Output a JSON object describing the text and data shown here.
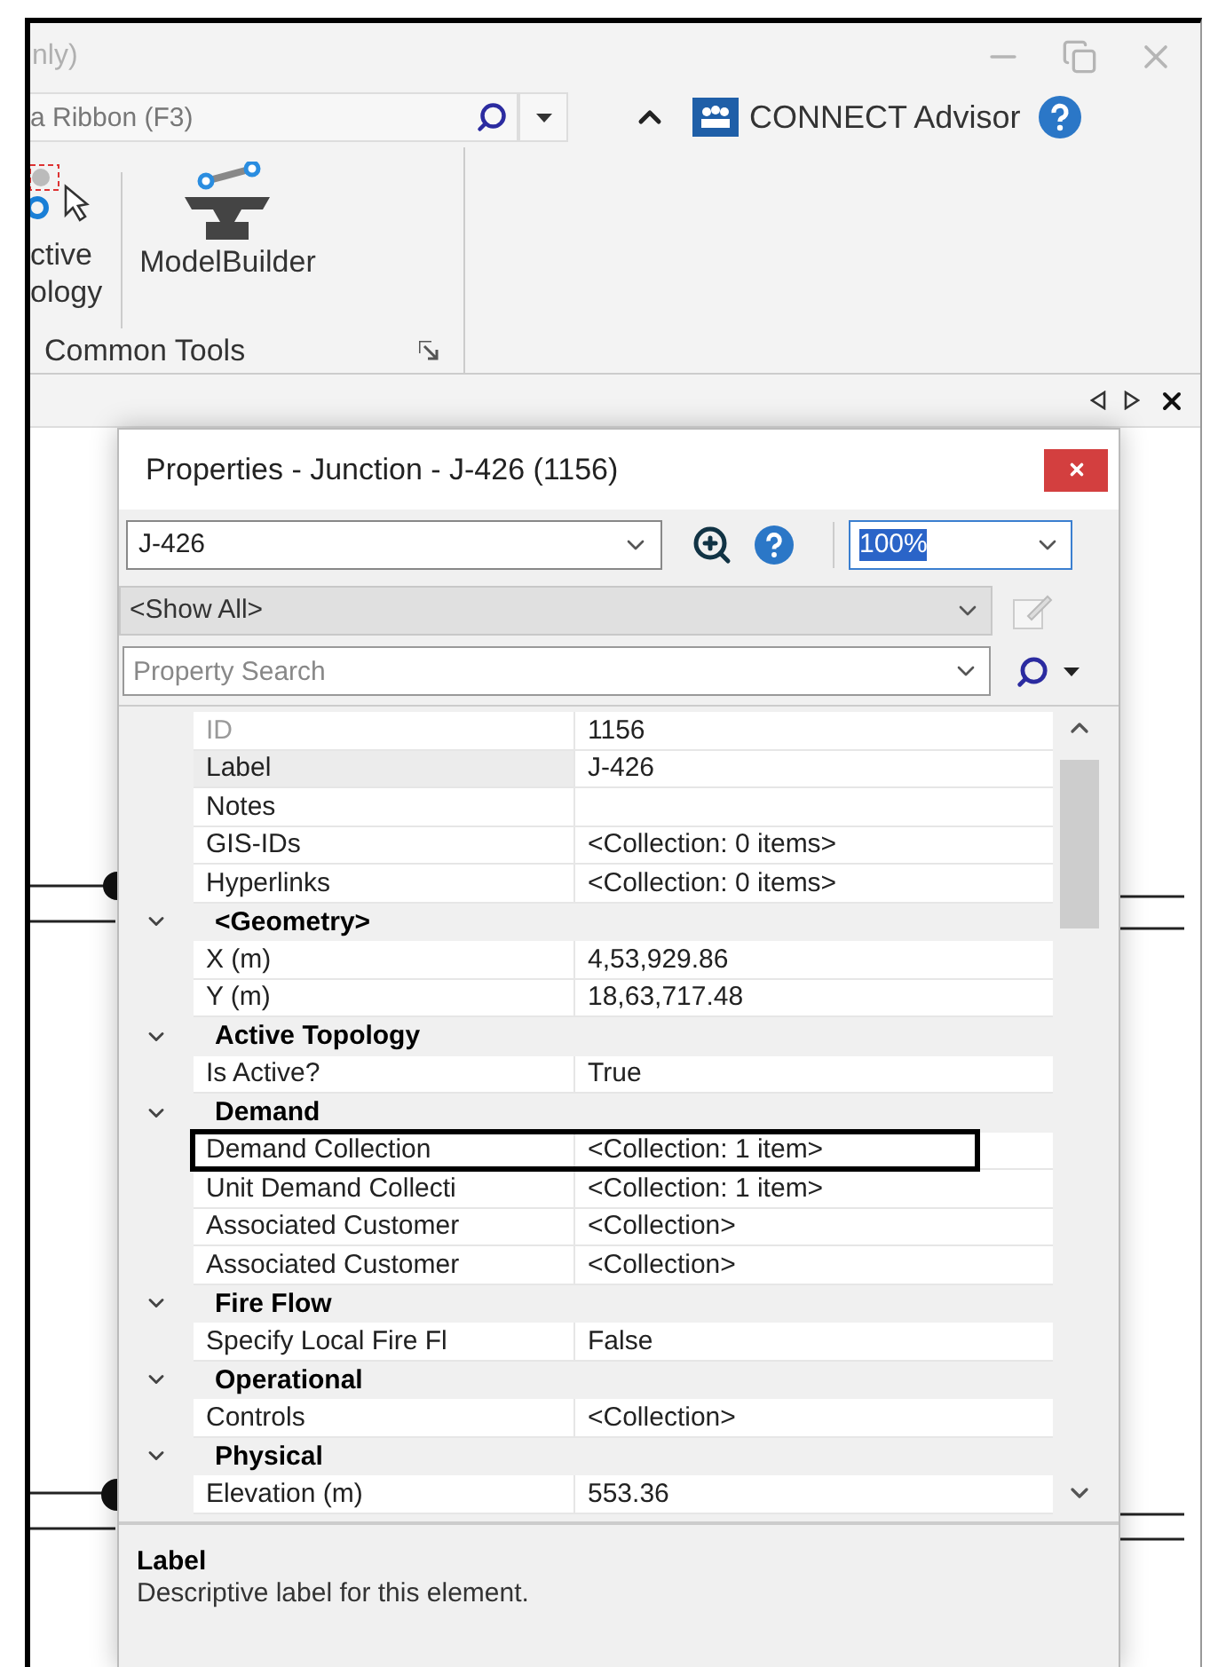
{
  "window": {
    "title": "nly)"
  },
  "ribbon_search": {
    "placeholder": "a Ribbon (F3)"
  },
  "connect_advisor": {
    "label": "CONNECT Advisor"
  },
  "ribbon": {
    "groups": [
      {
        "label": "Common Tools",
        "buttons": [
          {
            "kind": "topology",
            "lines": [
              "ctive",
              "ology"
            ]
          },
          {
            "kind": "modelbuilder",
            "lines": [
              "ModelBuilder"
            ]
          }
        ]
      }
    ]
  },
  "properties_dialog": {
    "title": "Properties - Junction - J-426 (1156)",
    "element": {
      "value": "J-426"
    },
    "zoom": {
      "value": "100%"
    },
    "filter": {
      "value": "<Show All>"
    },
    "search": {
      "placeholder": "Property Search"
    },
    "grid": [
      {
        "kind": "property",
        "name": "ID",
        "value": "1156",
        "disabled": true,
        "selected": false,
        "highlighted": false
      },
      {
        "kind": "property",
        "name": "Label",
        "value": "J-426",
        "disabled": false,
        "selected": true,
        "highlighted": false
      },
      {
        "kind": "property",
        "name": "Notes",
        "disabled": false,
        "selected": false,
        "highlighted": false
      },
      {
        "kind": "property",
        "name": "GIS-IDs",
        "value": "<Collection: 0 items>",
        "disabled": false,
        "selected": false,
        "highlighted": false
      },
      {
        "kind": "property",
        "name": "Hyperlinks",
        "value": "<Collection: 0 items>",
        "disabled": false,
        "selected": false,
        "highlighted": false
      },
      {
        "kind": "category",
        "name": "<Geometry>",
        "expanded": true,
        "children": [
          {
            "kind": "property",
            "name": "X (m)",
            "value": "4,53,929.86",
            "disabled": false,
            "selected": false,
            "highlighted": false
          },
          {
            "kind": "property",
            "name": "Y (m)",
            "value": "18,63,717.48",
            "disabled": false,
            "selected": false,
            "highlighted": false
          }
        ]
      },
      {
        "kind": "category",
        "name": "Active Topology",
        "expanded": true,
        "children": [
          {
            "kind": "property",
            "name": "Is Active?",
            "value": "True",
            "disabled": false,
            "selected": false,
            "highlighted": false
          }
        ]
      },
      {
        "kind": "category",
        "name": "Demand",
        "expanded": true,
        "children": [
          {
            "kind": "property",
            "name": "Demand Collection",
            "value": "<Collection: 1 item>",
            "disabled": false,
            "selected": false,
            "highlighted": true
          },
          {
            "kind": "property",
            "name": "Unit Demand Collecti",
            "value": "<Collection: 1 item>",
            "disabled": false,
            "selected": false,
            "highlighted": false
          },
          {
            "kind": "property",
            "name": "Associated Customer",
            "value": "<Collection>",
            "disabled": false,
            "selected": false,
            "highlighted": false
          },
          {
            "kind": "property",
            "name": "Associated Customer",
            "value": "<Collection>",
            "disabled": false,
            "selected": false,
            "highlighted": false
          }
        ]
      },
      {
        "kind": "category",
        "name": "Fire Flow",
        "expanded": true,
        "children": [
          {
            "kind": "property",
            "name": "Specify Local Fire Fl",
            "value": "False",
            "disabled": false,
            "selected": false,
            "highlighted": false
          }
        ]
      },
      {
        "kind": "category",
        "name": "Operational",
        "expanded": true,
        "children": [
          {
            "kind": "property",
            "name": "Controls",
            "value": "<Collection>",
            "disabled": false,
            "selected": false,
            "highlighted": false
          }
        ]
      },
      {
        "kind": "category",
        "name": "Physical",
        "expanded": true,
        "children": [
          {
            "kind": "property",
            "name": "Elevation (m)",
            "value": "553.36",
            "disabled": false,
            "selected": false,
            "highlighted": false
          }
        ]
      }
    ],
    "description": {
      "title": "Label",
      "text": "Descriptive label for this element."
    }
  }
}
